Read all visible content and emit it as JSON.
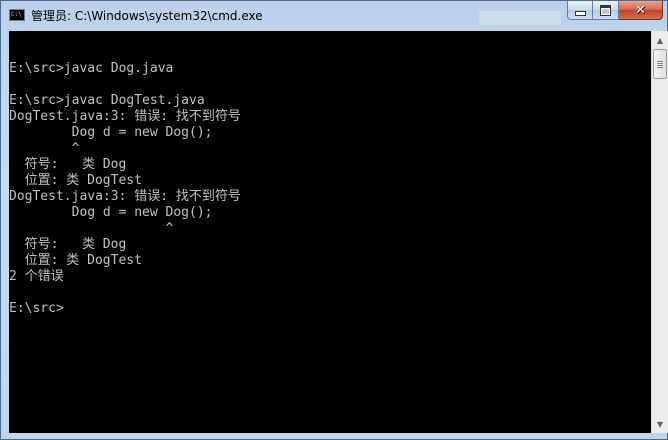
{
  "window": {
    "title": "管理员: C:\\Windows\\system32\\cmd.exe",
    "icon": "cmd-console-icon",
    "icon_text": "C:\\",
    "controls": {
      "minimize": "minimize-icon",
      "maximize": "maximize-icon",
      "close_glyph": "✕"
    }
  },
  "console": {
    "background": "#000000",
    "foreground": "#c0c0c0",
    "lines": [
      "",
      "E:\\src>javac Dog.java",
      "",
      "E:\\src>javac DogTest.java",
      "DogTest.java:3: 错误: 找不到符号",
      "        Dog d = new Dog();",
      "        ^",
      "  符号:   类 Dog",
      "  位置: 类 DogTest",
      "DogTest.java:3: 错误: 找不到符号",
      "        Dog d = new Dog();",
      "                    ^",
      "  符号:   类 Dog",
      "  位置: 类 DogTest",
      "2 个错误",
      "",
      "E:\\src>"
    ]
  },
  "scrollbar": {
    "up_arrow": "▲",
    "down_arrow": "▼"
  }
}
